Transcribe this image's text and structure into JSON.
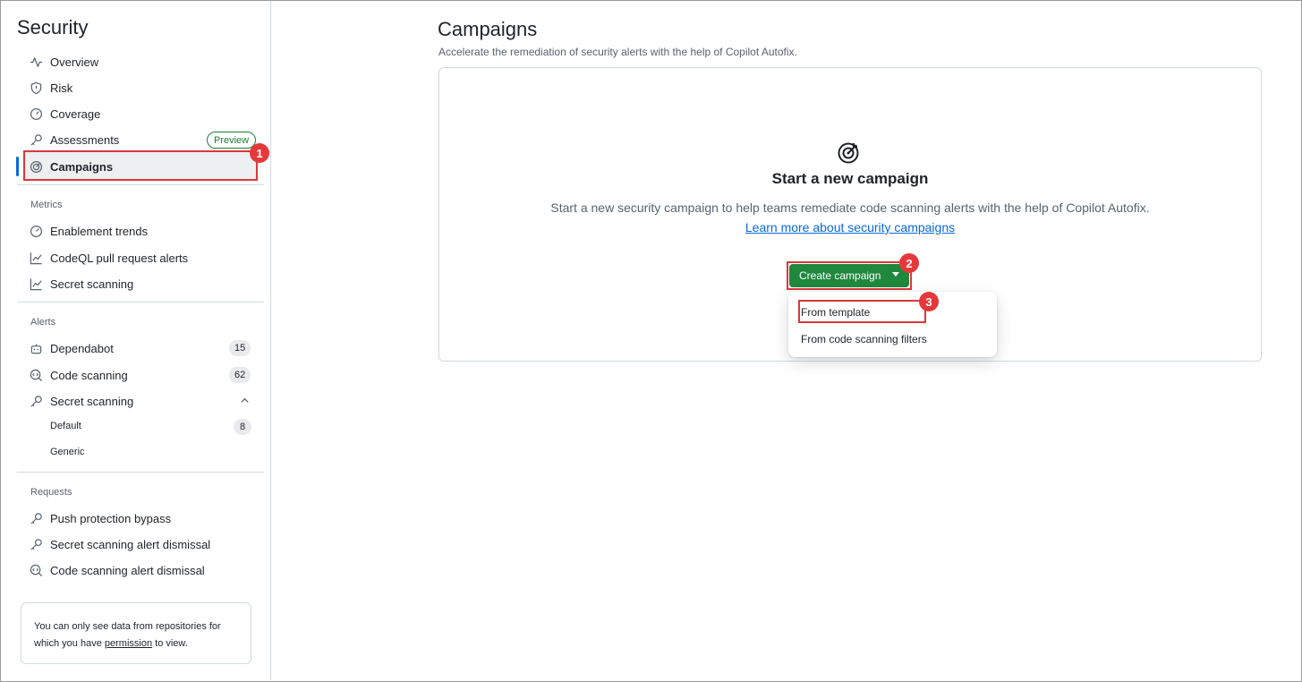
{
  "sidebar": {
    "title": "Security",
    "items": [
      {
        "label": "Overview",
        "icon": "pulse-icon"
      },
      {
        "label": "Risk",
        "icon": "shield-icon"
      },
      {
        "label": "Coverage",
        "icon": "meter-icon"
      },
      {
        "label": "Assessments",
        "icon": "key-icon",
        "badge": "Preview"
      },
      {
        "label": "Campaigns",
        "icon": "target-icon",
        "active": true
      }
    ],
    "metrics_label": "Metrics",
    "metrics": [
      {
        "label": "Enablement trends",
        "icon": "meter-icon"
      },
      {
        "label": "CodeQL pull request alerts",
        "icon": "graph-icon"
      },
      {
        "label": "Secret scanning",
        "icon": "graph-icon"
      }
    ],
    "alerts_label": "Alerts",
    "alerts": [
      {
        "label": "Dependabot",
        "icon": "dependabot-icon",
        "count": "15"
      },
      {
        "label": "Code scanning",
        "icon": "codescan-icon",
        "count": "62"
      },
      {
        "label": "Secret scanning",
        "icon": "key-icon"
      }
    ],
    "secret_sub": [
      {
        "label": "Default",
        "count": "8"
      },
      {
        "label": "Generic"
      }
    ],
    "requests_label": "Requests",
    "requests": [
      {
        "label": "Push protection bypass",
        "icon": "key-icon"
      },
      {
        "label": "Secret scanning alert dismissal",
        "icon": "key-icon"
      },
      {
        "label": "Code scanning alert dismissal",
        "icon": "codescan-icon"
      }
    ],
    "notice": {
      "before": "You can only see data from repositories for which you have ",
      "link": "permission",
      "after": " to view."
    }
  },
  "main": {
    "title": "Campaigns",
    "subtitle": "Accelerate the remediation of security alerts with the help of Copilot Autofix.",
    "empty_title": "Start a new campaign",
    "empty_desc": "Start a new security campaign to help teams remediate code scanning alerts with the help of Copilot Autofix.",
    "empty_link": "Learn more about security campaigns",
    "create_button": "Create campaign",
    "menu": [
      "From template",
      "From code scanning filters"
    ]
  },
  "markers": [
    "1",
    "2",
    "3"
  ],
  "colors": {
    "accent": "#0969da",
    "primary_button": "#1f883d",
    "highlight": "#d9383a"
  }
}
